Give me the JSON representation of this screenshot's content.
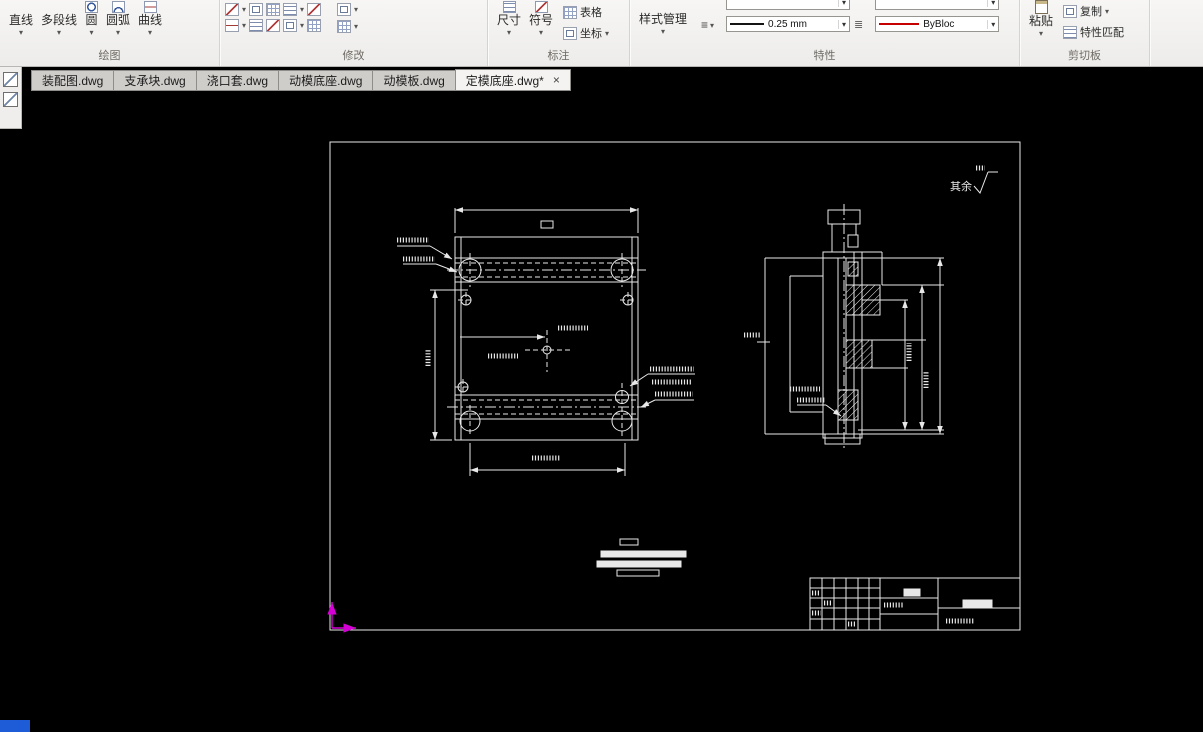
{
  "ribbon": {
    "panels": [
      {
        "label": "绘图"
      },
      {
        "label": "修改"
      },
      {
        "label": "标注"
      },
      {
        "label": "特性"
      },
      {
        "label": "剪切板"
      }
    ],
    "draw": {
      "tools": [
        {
          "label": "直线"
        },
        {
          "label": "多段线"
        },
        {
          "label": "圆"
        },
        {
          "label": "圆弧"
        },
        {
          "label": "曲线"
        }
      ]
    },
    "annotate": {
      "dimension": "尺寸",
      "symbol": "符号",
      "table": "表格",
      "coordinate": "坐标"
    },
    "properties": {
      "style_manager": "样式管理",
      "lineweight": "0.25 mm",
      "color": "ByBloc"
    },
    "clipboard": {
      "paste": "粘贴",
      "copy": "复制",
      "match": "特性匹配"
    }
  },
  "tabs": [
    {
      "label": "装配图.dwg"
    },
    {
      "label": "支承块.dwg"
    },
    {
      "label": "浇口套.dwg"
    },
    {
      "label": "动模底座.dwg"
    },
    {
      "label": "动模板.dwg"
    },
    {
      "label": "定模底座.dwg*",
      "active": true
    }
  ],
  "drawing": {
    "roughness_note": "其余"
  },
  "icons": {
    "dropdown": "▾",
    "close": "×",
    "menu": "≡",
    "list": "≣"
  },
  "colors": {
    "canvas": "#000000",
    "geometry": "#e8e8e8",
    "ucs": "#d400d4",
    "lineweight_sample": "#141414",
    "color_sample": "#cc0000",
    "status_corner": "#1e5bd7"
  }
}
